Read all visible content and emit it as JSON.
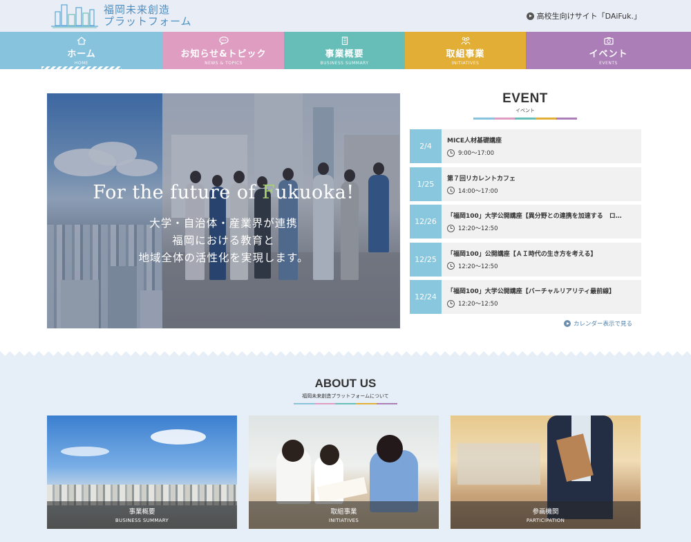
{
  "header": {
    "logo_line1": "福岡未来創造",
    "logo_line2": "プラットフォーム",
    "hs_link": "高校生向けサイト「DAiFuk.」"
  },
  "nav": [
    {
      "jp": "ホーム",
      "en": "HOME",
      "icon": "home-icon"
    },
    {
      "jp": "お知らせ&トピック",
      "en": "NEWS & TOPICS",
      "icon": "chat-bubble-icon"
    },
    {
      "jp": "事業概要",
      "en": "BUSINESS SUMMARY",
      "icon": "building-icon"
    },
    {
      "jp": "取組事業",
      "en": "INITIATIVES",
      "icon": "people-icon"
    },
    {
      "jp": "イベント",
      "en": "EVENTS",
      "icon": "camera-icon"
    }
  ],
  "hero": {
    "title_pre": "For the future of ",
    "title_f": "F",
    "title_post": "ukuoka!",
    "line1": "大学・自治体・産業界が連携",
    "line2": "福岡における教育と",
    "line3": "地域全体の活性化を実現します。"
  },
  "event": {
    "heading": "EVENT",
    "subheading": "イベント",
    "items": [
      {
        "date": "2/4",
        "title": "MICE人材基礎講座",
        "time": "9:00〜17:00"
      },
      {
        "date": "1/25",
        "title": "第７回リカレントカフェ",
        "time": "14:00〜17:00"
      },
      {
        "date": "12/26",
        "title": "「福岡100」大学公開講座【異分野との連携を加速する　ロ…",
        "time": "12:20〜12:50"
      },
      {
        "date": "12/25",
        "title": "「福岡100」公開講座【ＡＩ時代の生き方を考える】",
        "time": "12:20〜12:50"
      },
      {
        "date": "12/24",
        "title": "「福岡100」大学公開講座【バーチャルリアリティ最前線】",
        "time": "12:20〜12:50"
      }
    ],
    "calendar_link": "カレンダー表示で見る"
  },
  "about": {
    "heading": "ABOUT US",
    "subheading": "福岡未来創造プラットフォームについて",
    "cards": [
      {
        "jp": "事業概要",
        "en": "BUSINESS SUMMARY"
      },
      {
        "jp": "取組事業",
        "en": "INITIATIVES"
      },
      {
        "jp": "参画機関",
        "en": "PARTICIPATION"
      }
    ]
  },
  "colors": {
    "home": "#88c3de",
    "news": "#df9dc2",
    "business": "#67bdb8",
    "initiatives": "#e2ae35",
    "events": "#ab7eb7",
    "event_date": "#88c7de"
  }
}
